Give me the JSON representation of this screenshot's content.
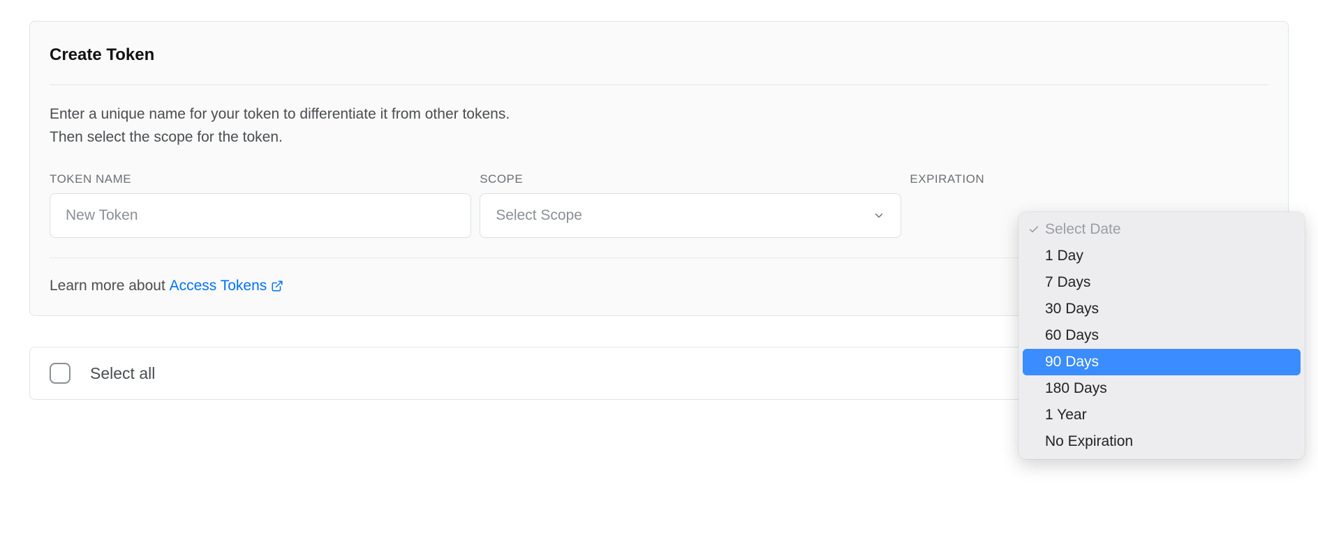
{
  "card": {
    "title": "Create Token",
    "description_line1": "Enter a unique name for your token to differentiate it from other tokens.",
    "description_line2": "Then select the scope for the token."
  },
  "fields": {
    "token_name": {
      "label": "TOKEN NAME",
      "placeholder": "New Token",
      "value": ""
    },
    "scope": {
      "label": "SCOPE",
      "placeholder": "Select Scope"
    },
    "expiration": {
      "label": "EXPIRATION"
    }
  },
  "learn_more": {
    "prefix": "Learn more about ",
    "link_text": "Access Tokens"
  },
  "dropdown": {
    "header": "Select Date",
    "options": [
      "1 Day",
      "7 Days",
      "30 Days",
      "60 Days",
      "90 Days",
      "180 Days",
      "1 Year",
      "No Expiration"
    ],
    "highlighted_index": 4
  },
  "select_all": {
    "label": "Select all",
    "checked": false
  }
}
